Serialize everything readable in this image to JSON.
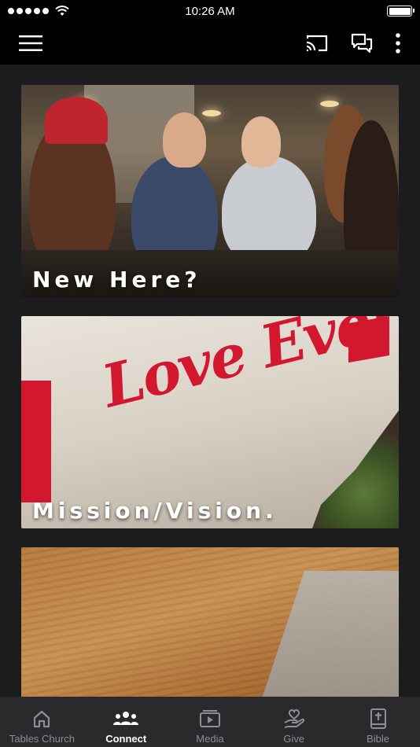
{
  "status_bar": {
    "time": "10:26 AM"
  },
  "app_bar": {
    "menu_icon": "hamburger-menu-icon",
    "cast_icon": "cast-icon",
    "chat_icon": "chat-icon",
    "more_icon": "more-vertical-icon"
  },
  "cards": [
    {
      "title": "New Here?"
    },
    {
      "title": "Mission/Vision.",
      "mural_text": "Love Everyone"
    },
    {
      "title": ""
    }
  ],
  "tabs": [
    {
      "label": "Tables Church",
      "icon": "home-icon",
      "active": false
    },
    {
      "label": "Connect",
      "icon": "people-icon",
      "active": true
    },
    {
      "label": "Media",
      "icon": "play-icon",
      "active": false
    },
    {
      "label": "Give",
      "icon": "give-heart-hand-icon",
      "active": false
    },
    {
      "label": "Bible",
      "icon": "bible-icon",
      "active": false
    }
  ],
  "colors": {
    "background": "#1c1c1e",
    "bar": "#000000",
    "tab_bar": "#2a2a2c",
    "accent_red": "#d3172f"
  }
}
